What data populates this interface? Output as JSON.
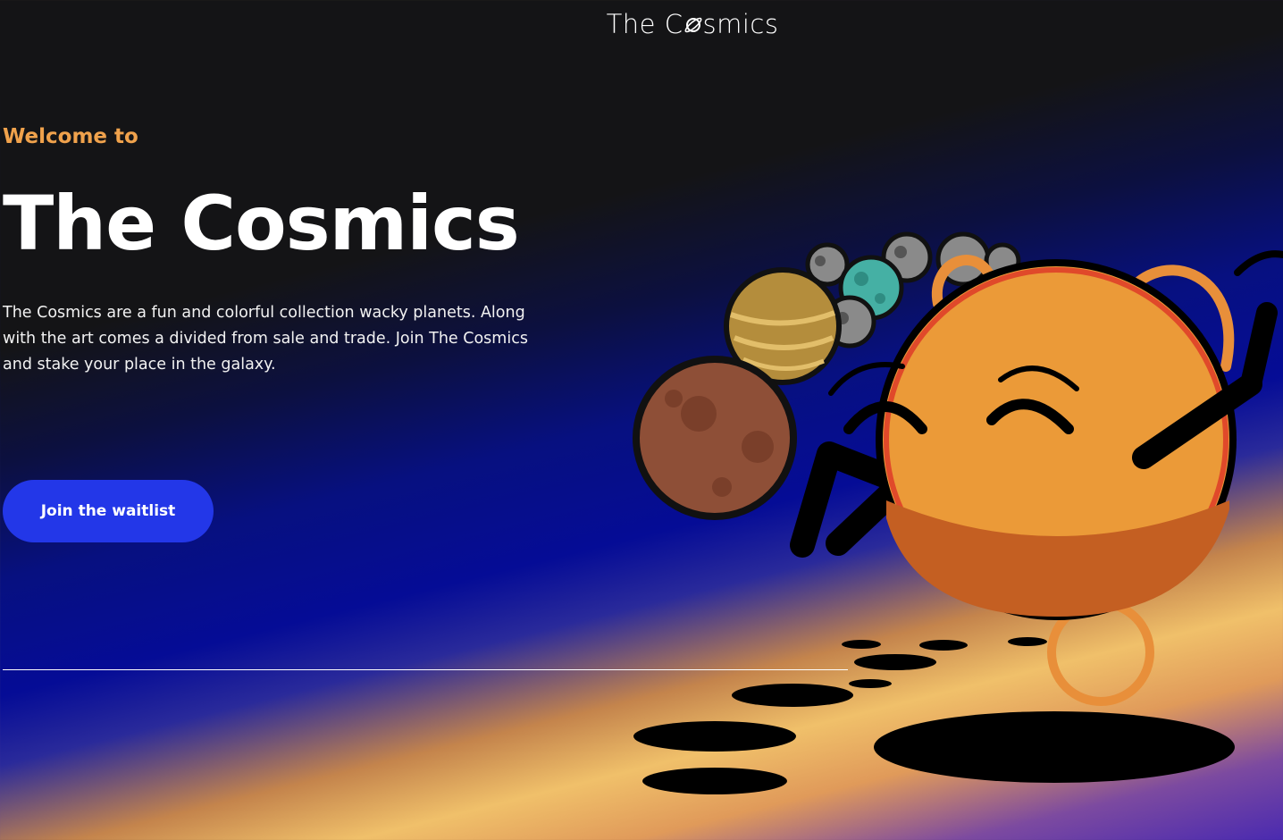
{
  "header": {
    "logo_prefix": "The C",
    "logo_suffix": "smics",
    "logo_icon": "planet-ring-icon"
  },
  "hero": {
    "eyebrow": "Welcome to",
    "title": "The Cosmics",
    "description": "The Cosmics are a fun and colorful collection wacky planets. Along with the art comes a divided from sale and trade. Join The Cosmics and stake your place in the galaxy.",
    "cta_label": "Join the waitlist"
  },
  "colors": {
    "accent_orange": "#f0a24c",
    "cta_blue": "#2337e8",
    "background_dark": "#141416"
  }
}
